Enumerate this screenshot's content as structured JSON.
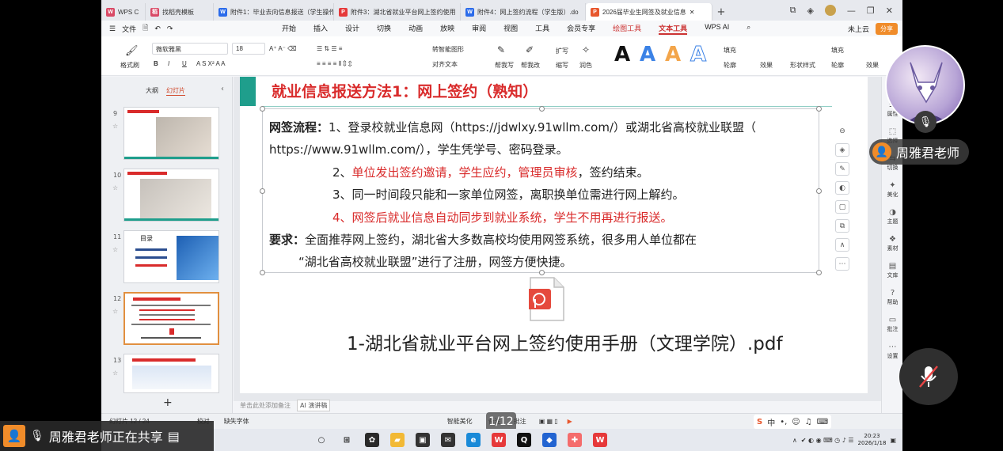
{
  "tabs": [
    {
      "label": "WPS C",
      "icon": "wps-icon",
      "type": "m"
    },
    {
      "label": "找稻壳模板",
      "icon": "docer-icon",
      "type": "m"
    },
    {
      "label": "附件1：毕业去向信息报送（学生操作",
      "icon": "word-doc-icon",
      "type": "w"
    },
    {
      "label": "附件3：湖北省就业平台网上签约使用",
      "icon": "pdf-doc-icon",
      "type": "r"
    },
    {
      "label": "附件4：网上签约流程（学生版）.do",
      "icon": "word-doc-icon",
      "type": "w"
    },
    {
      "label": "2026届毕业生网签及就业信息",
      "icon": "ppt-doc-icon",
      "type": "p",
      "active": true
    }
  ],
  "menu": {
    "file": "文件",
    "items": [
      "开始",
      "插入",
      "设计",
      "切换",
      "动画",
      "放映",
      "审阅",
      "视图",
      "工具",
      "会员专享",
      "绘图工具",
      "文本工具",
      "WPS AI"
    ],
    "active": "文本工具",
    "cloud": "未上云",
    "share": "分享"
  },
  "toolbar": {
    "format_painter": "格式刷",
    "font": "微软雅黑",
    "size": "18",
    "smart_shape": "转智能图形",
    "paragraph": "对齐文本",
    "help_write": "帮我写",
    "help_edit": "帮我改",
    "expand": "扩写",
    "shrink": "缩写",
    "polish": "润色",
    "fill": "填充",
    "outline": "轮廓",
    "effect": "效果",
    "shape_style": "形状样式",
    "shape_fill": "填充",
    "shape_outline": "轮廓",
    "shape_effect": "效果"
  },
  "sidepanel": {
    "tab_outline": "大纲",
    "tab_slides": "幻灯片",
    "thumbs": [
      {
        "num": "9",
        "title": "附件一：..."
      },
      {
        "num": "10",
        "title": "附件二：..."
      },
      {
        "num": "11",
        "title": "目录"
      },
      {
        "num": "12",
        "title": "就业信息报送方法1：网上签约（熟知）",
        "selected": true
      },
      {
        "num": "13",
        "title": "就业信息报送方法1：网上签约"
      }
    ]
  },
  "slide": {
    "title": "就业信息报送方法1：网上签约（熟知）",
    "flow_label": "网签流程：",
    "line1": "1、登录校就业信息网（https://jdwlxy.91wllm.com/）或湖北省高校就业联盟（",
    "line2": "https://www.91wllm.com/），学生凭学号、密码登录。",
    "line3_num": "2、",
    "line3_red": "单位发出签约邀请，学生应约，管理员审核",
    "line3_end": "，签约结束。",
    "line4": "3、同一时间段只能和一家单位网签，离职换单位需进行网上解约。",
    "line5_num": "4、",
    "line5_red": "网签后就业信息自动同步到就业系统，学生不用再进行报送。",
    "req_label": "要求：",
    "req_text": "全面推荐网上签约，湖北省大多数高校均使用网签系统，很多用人单位都在",
    "req_text2": "“湖北省高校就业联盟”进行了注册，网签方便快捷。",
    "pdf_caption": "1-湖北省就业平台网上签约使用手册（文理学院）.pdf"
  },
  "notes_hint": "单击此处添加备注",
  "ai_notes": "AI 演讲稿",
  "rightbar": [
    "属性",
    "选择",
    "切换",
    "美化",
    "主题",
    "素材",
    "文库",
    "帮助",
    "批注",
    "设置"
  ],
  "status": {
    "slide_info": "幻灯片 12 / 24",
    "proofread": "校对",
    "missing_font": "缺失字体",
    "smart_beautify": "智能美化",
    "notes": "备注",
    "comments": "批注",
    "page_indicator": "1/12"
  },
  "taskbar": {
    "ime": "中",
    "time": "20:23",
    "date": "2026/1/18"
  },
  "overlay": {
    "teacher_name": "周雅君老师",
    "sharing": "周雅君老师正在共享"
  },
  "colors": {
    "accent_red": "#d92b2b",
    "teal": "#1f9e8c",
    "orange": "#f08c2a"
  }
}
